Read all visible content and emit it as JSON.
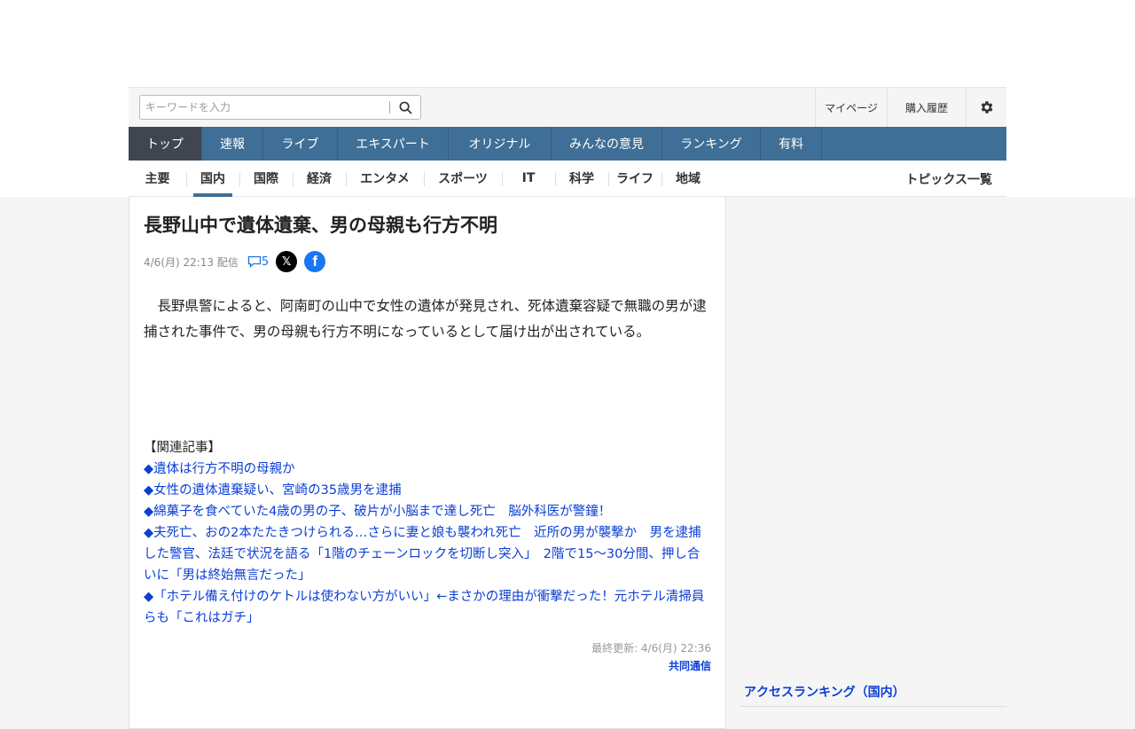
{
  "header": {
    "search_placeholder": "キーワードを入力",
    "mypage": "マイページ",
    "purchase_history": "購入履歴"
  },
  "global_nav": [
    "トップ",
    "速報",
    "ライブ",
    "エキスパート",
    "オリジナル",
    "みんなの意見",
    "ランキング",
    "有料"
  ],
  "sub_nav": [
    "主要",
    "国内",
    "国際",
    "経済",
    "エンタメ",
    "スポーツ",
    "IT",
    "科学",
    "ライフ",
    "地域"
  ],
  "topics_link": "トピックス一覧",
  "article": {
    "title": "長野山中で遺体遺棄、男の母親も行方不明",
    "date": "4/6(月) 22:13 配信",
    "comment_count": "5",
    "body": "　長野県警によると、阿南町の山中で女性の遺体が発見され、死体遺棄容疑で無職の男が逮捕された事件で、男の母親も行方不明になっているとして届け出が出されている。",
    "related_heading": "【関連記事】",
    "related": [
      "◆遺体は行方不明の母親か",
      "◆女性の遺体遺棄疑い、宮崎の35歳男を逮捕",
      "◆綿菓子を食べていた4歳の男の子、破片が小脳まで達し死亡　脳外科医が警鐘！",
      "◆夫死亡、おの2本たたきつけられる…さらに妻と娘も襲われ死亡　近所の男が襲撃か　男を逮捕した警官、法廷で状況を語る「1階のチェーンロックを切断し突入」　2階で15～30分間、押し合いに「男は終始無言だった」",
      "◆「ホテル備え付けのケトルは使わない方がいい」←まさかの理由が衝撃だった！元ホテル清掃員らも「これはガチ」"
    ],
    "updated": "最終更新: 4/6(月) 22:36",
    "source": "共同通信"
  },
  "sidebar": {
    "ranking_title": "アクセスランキング（国内）"
  }
}
